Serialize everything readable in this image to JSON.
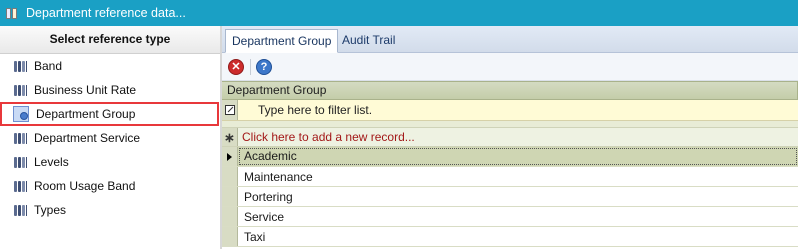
{
  "window": {
    "title": "Department reference data..."
  },
  "left": {
    "header": "Select reference type",
    "items": [
      {
        "label": "Band",
        "icon": "database-icon"
      },
      {
        "label": "Business Unit Rate",
        "icon": "database-icon"
      },
      {
        "label": "Department Group",
        "icon": "database-edit-icon",
        "selected": true
      },
      {
        "label": "Department Service",
        "icon": "database-icon"
      },
      {
        "label": "Levels",
        "icon": "database-icon"
      },
      {
        "label": "Room Usage Band",
        "icon": "database-icon"
      },
      {
        "label": "Types",
        "icon": "database-icon"
      }
    ]
  },
  "tabs": [
    {
      "label": "Department Group",
      "active": true
    },
    {
      "label": "Audit Trail",
      "active": false
    }
  ],
  "toolbar": {
    "delete_icon": "delete-icon",
    "help_icon": "help-icon"
  },
  "grid": {
    "caption": "Department Group",
    "filter_placeholder": "Type here to filter list.",
    "add_record": "Click here to add a new record...",
    "rows": [
      "Academic",
      "Maintenance",
      "Portering",
      "Service",
      "Taxi"
    ]
  },
  "colors": {
    "titlebar": "#1aa0c5",
    "selected_outline": "#e8383b",
    "add_record_text": "#a31919",
    "filter_row_bg": "#fffbd6"
  }
}
